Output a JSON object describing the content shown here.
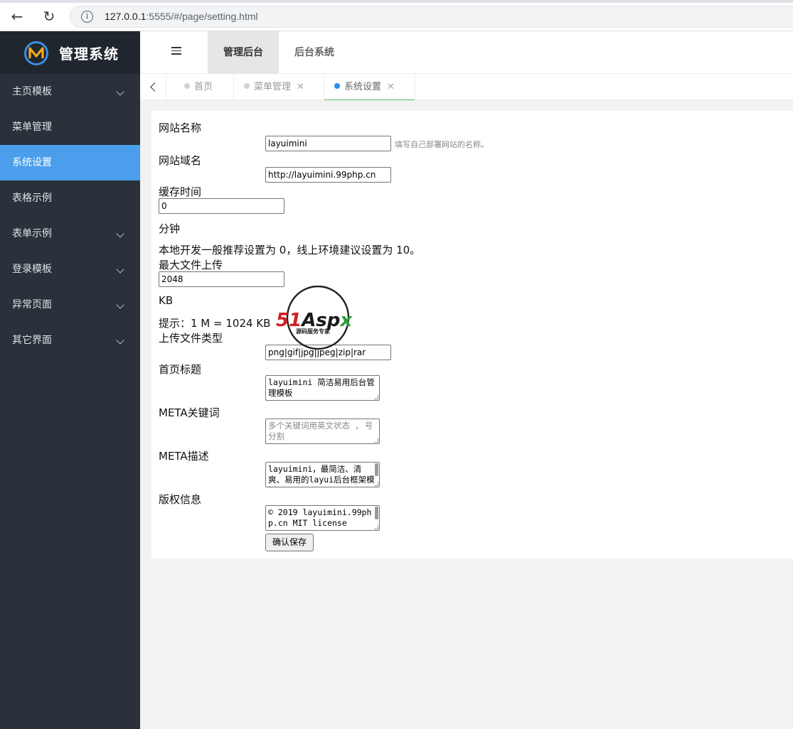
{
  "browser": {
    "url_host": "127.0.0.1",
    "url_rest": ":5555/#/page/setting.html"
  },
  "sidebar": {
    "logo_text": "管理系统",
    "items": [
      {
        "label": "主页模板",
        "has_arrow": true
      },
      {
        "label": "菜单管理",
        "has_arrow": false
      },
      {
        "label": "系统设置",
        "has_arrow": false,
        "active": true
      },
      {
        "label": "表格示例",
        "has_arrow": false
      },
      {
        "label": "表单示例",
        "has_arrow": true
      },
      {
        "label": "登录模板",
        "has_arrow": true
      },
      {
        "label": "异常页面",
        "has_arrow": true
      },
      {
        "label": "其它界面",
        "has_arrow": true
      }
    ]
  },
  "header": {
    "tabs": [
      {
        "label": "管理后台",
        "active": true
      },
      {
        "label": "后台系统",
        "active": false
      }
    ]
  },
  "page_tabs": [
    {
      "label": "首页",
      "closable": false
    },
    {
      "label": "菜单管理",
      "closable": true
    },
    {
      "label": "系统设置",
      "closable": true,
      "active": true
    }
  ],
  "form": {
    "site_name": {
      "label": "网站名称",
      "value": "layuimini",
      "hint": "填写自己部署网站的名称。"
    },
    "site_domain": {
      "label": "网站域名",
      "value": "http://layuimini.99php.cn"
    },
    "cache_time": {
      "label": "缓存时间",
      "value": "0",
      "unit": "分钟",
      "note": "本地开发一般推荐设置为 0，线上环境建议设置为 10。"
    },
    "max_upload": {
      "label": "最大文件上传",
      "value": "2048",
      "unit": "KB",
      "note": "提示：1 M = 1024 KB"
    },
    "upload_types": {
      "label": "上传文件类型",
      "value": "png|gif|jpg|jpeg|zip|rar"
    },
    "home_title": {
      "label": "首页标题",
      "value": "layuimini 简洁易用后台管理模板"
    },
    "meta_keywords": {
      "label": "META关键词",
      "placeholder": "多个关键词用英文状态 , 号分割"
    },
    "meta_desc": {
      "label": "META描述",
      "value": "layuimini，最简洁、清爽、易用的layui后台框架模板。"
    },
    "copyright": {
      "label": "版权信息",
      "value": "© 2019 layuimini.99php.cn MIT license"
    },
    "save_label": "确认保存"
  },
  "watermark": {
    "brand": "51Aspx",
    "tagline": "源码服务专家"
  },
  "colors": {
    "sidebar_bg": "#2a313a",
    "logo_bg": "#20262d",
    "active_menu": "#4a9eeb",
    "active_tab_underline": "#5fb878",
    "active_tab_dot": "#2d8cf0"
  }
}
